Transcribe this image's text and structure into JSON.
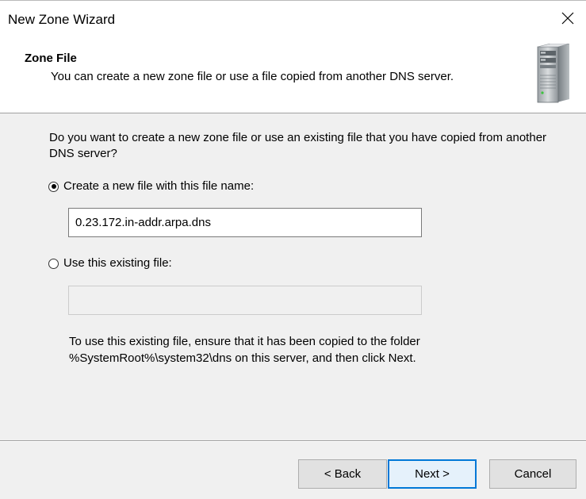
{
  "window": {
    "title": "New Zone Wizard"
  },
  "header": {
    "title": "Zone File",
    "subtitle": "You can create a new zone file or use a file copied from another DNS server.",
    "icon": "server-icon"
  },
  "body": {
    "question": "Do you want to create a new zone file or use an existing file that you have copied from another DNS server?",
    "option_new": {
      "label": "Create a new file with this file name:",
      "selected": true,
      "value": "0.23.172.in-addr.arpa.dns"
    },
    "option_existing": {
      "label": "Use this existing file:",
      "selected": false,
      "value": ""
    },
    "note_line1": "To use this existing file, ensure that it has been copied to the folder",
    "note_line2": "%SystemRoot%\\system32\\dns on this server, and then click Next."
  },
  "footer": {
    "back_label": "< Back",
    "next_label": "Next >",
    "cancel_label": "Cancel"
  },
  "colors": {
    "accent": "#0078d7",
    "dialog_bg": "#f0f0f0",
    "header_bg": "#ffffff"
  }
}
